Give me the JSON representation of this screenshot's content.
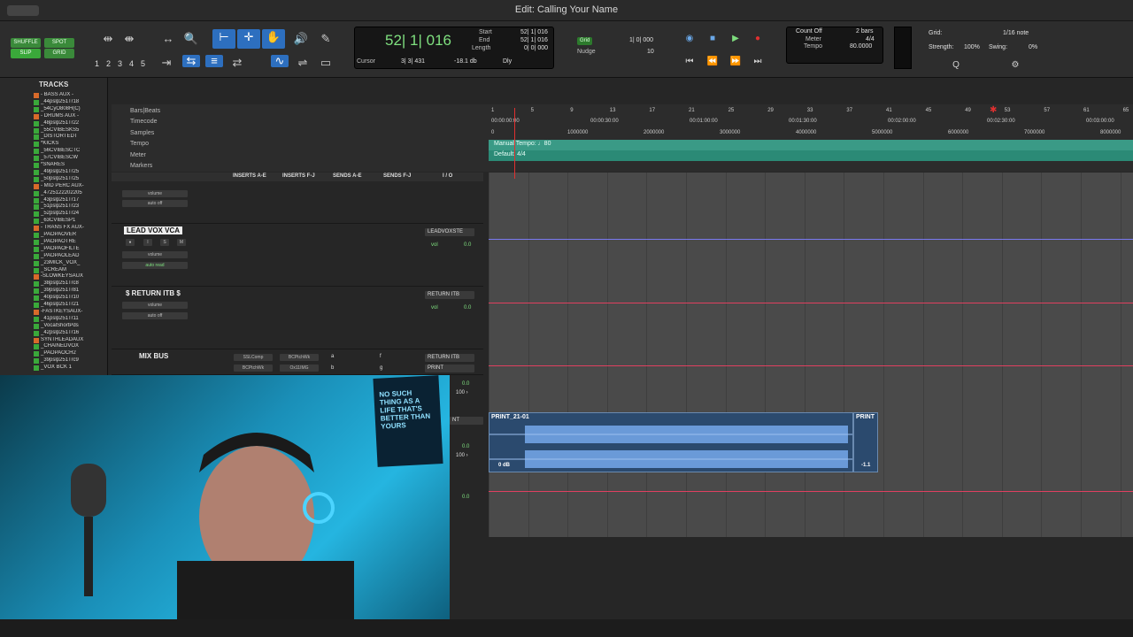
{
  "window": {
    "title": "Edit: Calling Your Name"
  },
  "modes": {
    "shuffle": "SHUFFLE",
    "spot": "SPOT",
    "slip": "SLIP",
    "grid": "GRID"
  },
  "zoom_presets": [
    "1",
    "2",
    "3",
    "4",
    "5"
  ],
  "counter": {
    "main": "52| 1| 016",
    "start_label": "Start",
    "start": "52| 1| 016",
    "end_label": "End",
    "end": "52| 1| 016",
    "length_label": "Length",
    "length": "0| 0| 000",
    "cursor_label": "Cursor",
    "cursor": "3| 3| 431",
    "cursor_db": "-18.1 db",
    "dly_label": "Dly"
  },
  "grid": {
    "grid_label": "Grid",
    "grid_value": "1| 0| 000",
    "nudge_label": "Nudge",
    "nudge_value": "10"
  },
  "countoff": {
    "count_off": "Count Off",
    "bars": "2 bars",
    "meter_label": "Meter",
    "meter": "4/4",
    "tempo_label": "Tempo",
    "tempo": "80.0000"
  },
  "right_panel": {
    "grid_label": "Grid:",
    "grid_value": "1/16 note",
    "strength_label": "Strength:",
    "strength": "100%",
    "swing_label": "Swing:",
    "swing": "0%"
  },
  "ruler": {
    "rows": [
      "Bars|Beats",
      "Timecode",
      "Samples",
      "Tempo",
      "Meter",
      "Markers"
    ],
    "bars": [
      "1",
      "5",
      "9",
      "13",
      "17",
      "21",
      "25",
      "29",
      "33",
      "37",
      "41",
      "45",
      "49",
      "53",
      "57",
      "61",
      "65"
    ],
    "timecode": [
      "00:00:00:00",
      "00:00:30:00",
      "00:01:00:00",
      "00:01:30:00",
      "00:02:00:00",
      "00:02:30:00",
      "00:03:00:00"
    ],
    "samples": [
      "0",
      "1000000",
      "2000000",
      "3000000",
      "4000000",
      "5000000",
      "6000000",
      "7000000",
      "8000000"
    ],
    "tempo_text": "Manual Tempo: ♩80",
    "meter_text": "Default: 4/4"
  },
  "tracks_panel": {
    "header": "TRACKS",
    "items": [
      "- BASS AUX -",
      "_44pslp251Tr18",
      "_54CyO808H(C)",
      "- DRUMS AUX -",
      "_48pslp251Tr22",
      "_55CVIBESKS5",
      "_DISTORTEDT",
      "*KICKS",
      "_56CVIBESCTC",
      "_57CVIBESCW",
      "*SNARES",
      "_49pslp251Tr25",
      "_50pslp251Tr25",
      "- MID PERC AUX-",
      "_4725122202205",
      "_43pslp251Tr17",
      "_51pslp251Tr23",
      "_52pslp251Tr24",
      "_63CVIBESP1",
      "- TRANS FX AUX-",
      "_PAOPAOVER",
      "_PAOPAOTRE",
      "_PAOPAOFILTE",
      "_PAOPAOLEAD",
      "_23MICK_VOX_",
      "_SCREAM",
      "-SLOWKEYSAUX",
      "_38pslp251Trc8",
      "_39pslp251Tr81",
      "_40pslp251Tr10",
      "_46pslp251Tr21",
      "-FASTKEYSAUX-",
      "_41pslp251Tr11",
      "_VocalShortPds",
      "_42pslp251Tr16",
      "SYNTHLEADAUX",
      "_CHAINEDVOX",
      "_PAOPAOCH2",
      "_39pslp251Trc9",
      "_VOX BCK 1"
    ]
  },
  "mix_header": {
    "inserts_ae": "INSERTS A-E",
    "inserts_fj": "INSERTS F-J",
    "sends_ae": "SENDS A-E",
    "sends_fj": "SENDS F-J",
    "io": "I / O"
  },
  "lanes": {
    "lane0": {
      "vol": "vol",
      "volume": "volume",
      "auto": "auto off"
    },
    "leadvox": {
      "name": "LEAD VOX VCA",
      "volume": "volume",
      "auto": "auto read",
      "io": "LEADVOXSTE",
      "vol": "vol",
      "vol_val": "0.0"
    },
    "return": {
      "name": "$ RETURN ITB $",
      "volume": "volume",
      "auto": "auto off",
      "io": "RETURN ITB",
      "vol": "vol",
      "vol_val": "0.0"
    },
    "mixbus": {
      "name": "MIX BUS",
      "insert1": "SSLComp",
      "insert2": "BCPtchWk",
      "insert3": "BCPtchWk",
      "insert4": "Ox11IMG",
      "send_a": "a",
      "send_b": "b",
      "send_f": "f",
      "send_g": "g",
      "io1": "RETURN ITB",
      "io2": "PRINT",
      "vol_val": "0.0",
      "pan_val": "100 ›"
    },
    "print": {
      "io_partial": "NT",
      "vol_val": "0.0",
      "pan_val": "100 ›"
    },
    "last": {
      "vol_val": "0.0"
    }
  },
  "clips": {
    "clip1": "PRINT_21-01",
    "clip2": "PRINT",
    "gain": "0 dB",
    "gain2": "-1.1"
  },
  "solo_mute": {
    "solo": "S",
    "mute": "M",
    "input": "I"
  },
  "poster_text": "NO SUCH THING AS A LIFE THAT'S BETTER THAN YOURS"
}
